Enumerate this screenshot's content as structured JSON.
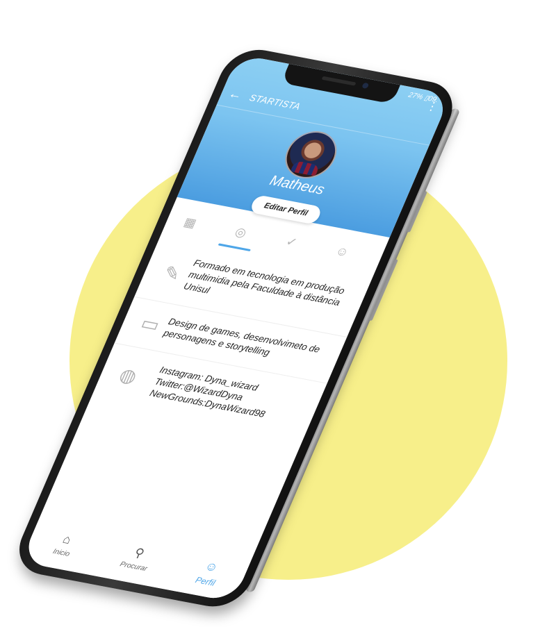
{
  "status": {
    "text": "27% ▯09."
  },
  "app": {
    "title": "STARTISTA"
  },
  "icons": {
    "back": "←",
    "menu": "⋮",
    "tab_grid": "▦",
    "tab_ideas": "◎",
    "tab_done": "✓",
    "tab_user": "☺",
    "diploma": "✎",
    "briefcase": "▭",
    "globe": "◍",
    "home": "⌂",
    "search": "⚲",
    "profile": "☺"
  },
  "profile": {
    "name": "Matheus",
    "edit_label": "Editar Perfil"
  },
  "info": {
    "education": "Formado em tecnologia em produção multimidia pela Faculdade à distância Unisul",
    "work": "Design de games, desenvolvimeto de personagens e storytelling",
    "social": [
      "Instagram: Dyna_wizard",
      "Twitter:@WizardDyna",
      "NewGrounds:DynaWizard98"
    ]
  },
  "nav": {
    "items": [
      {
        "label": "Inicio"
      },
      {
        "label": "Procurar"
      },
      {
        "label": "Perfil"
      }
    ]
  },
  "colors": {
    "accent": "#4ea6e8",
    "header_top": "#8ccff3",
    "header_bottom": "#4b9de0",
    "background_circle": "#f7ef8a"
  }
}
